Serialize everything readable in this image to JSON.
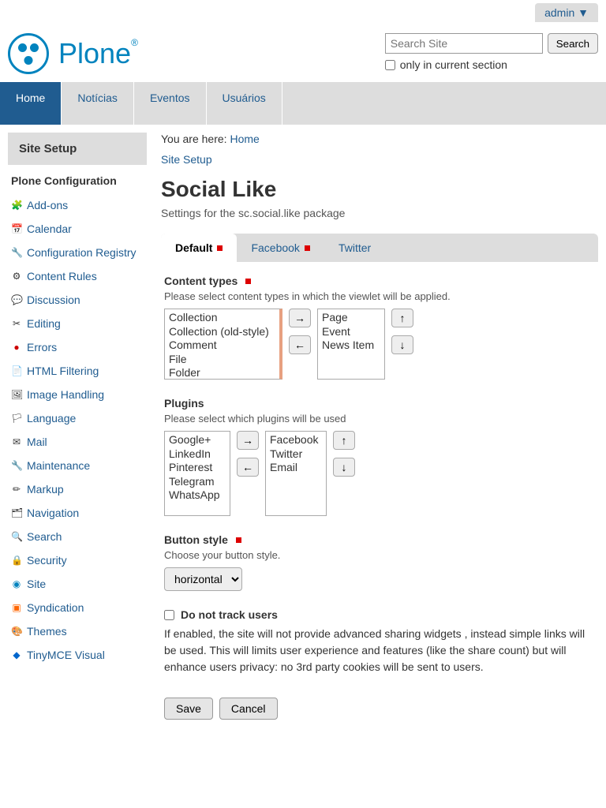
{
  "admin": {
    "label": "admin ▼"
  },
  "logo": {
    "text": "Plone"
  },
  "search": {
    "placeholder": "Search Site",
    "button": "Search",
    "only_label": "only in current section"
  },
  "nav": {
    "home": "Home",
    "noticias": "Notícias",
    "eventos": "Eventos",
    "usuarios": "Usuários"
  },
  "breadcrumb": {
    "prefix": "You are here: ",
    "home": "Home"
  },
  "setup_link": "Site Setup",
  "page": {
    "title": "Social Like",
    "desc": "Settings for the sc.social.like package"
  },
  "tabs": {
    "default": "Default",
    "facebook": "Facebook",
    "twitter": "Twitter"
  },
  "sidebar": {
    "header": "Site Setup",
    "section_title": "Plone Configuration",
    "items": {
      "addons": "Add-ons",
      "calendar": "Calendar",
      "config_registry": "Configuration Registry",
      "content_rules": "Content Rules",
      "discussion": "Discussion",
      "editing": "Editing",
      "errors": "Errors",
      "html_filtering": "HTML Filtering",
      "image_handling": "Image Handling",
      "language": "Language",
      "mail": "Mail",
      "maintenance": "Maintenance",
      "markup": "Markup",
      "navigation": "Navigation",
      "search": "Search",
      "security": "Security",
      "site": "Site",
      "syndication": "Syndication",
      "themes": "Themes",
      "tinymce": "TinyMCE Visual"
    }
  },
  "fields": {
    "content_types": {
      "label": "Content types",
      "help": "Please select content types in which the viewlet will be applied.",
      "left": [
        "Collection",
        "Collection (old-style)",
        "Comment",
        "File",
        "Folder"
      ],
      "right": [
        "Page",
        "Event",
        "News Item"
      ]
    },
    "plugins": {
      "label": "Plugins",
      "help": "Please select which plugins will be used",
      "left": [
        "Google+",
        "LinkedIn",
        "Pinterest",
        "Telegram",
        "WhatsApp"
      ],
      "right": [
        "Facebook",
        "Twitter",
        "Email"
      ]
    },
    "button_style": {
      "label": "Button style",
      "help": "Choose your button style.",
      "value": "horizontal"
    },
    "dnt": {
      "label": "Do not track users",
      "desc": "If enabled, the site will not provide advanced sharing widgets , instead simple links will be used. This will limits user experience and features (like the share count) but will enhance users privacy: no 3rd party cookies will be sent to users."
    }
  },
  "buttons": {
    "move_right": "→",
    "move_left": "←",
    "move_up": "↑",
    "move_down": "↓",
    "save": "Save",
    "cancel": "Cancel"
  }
}
